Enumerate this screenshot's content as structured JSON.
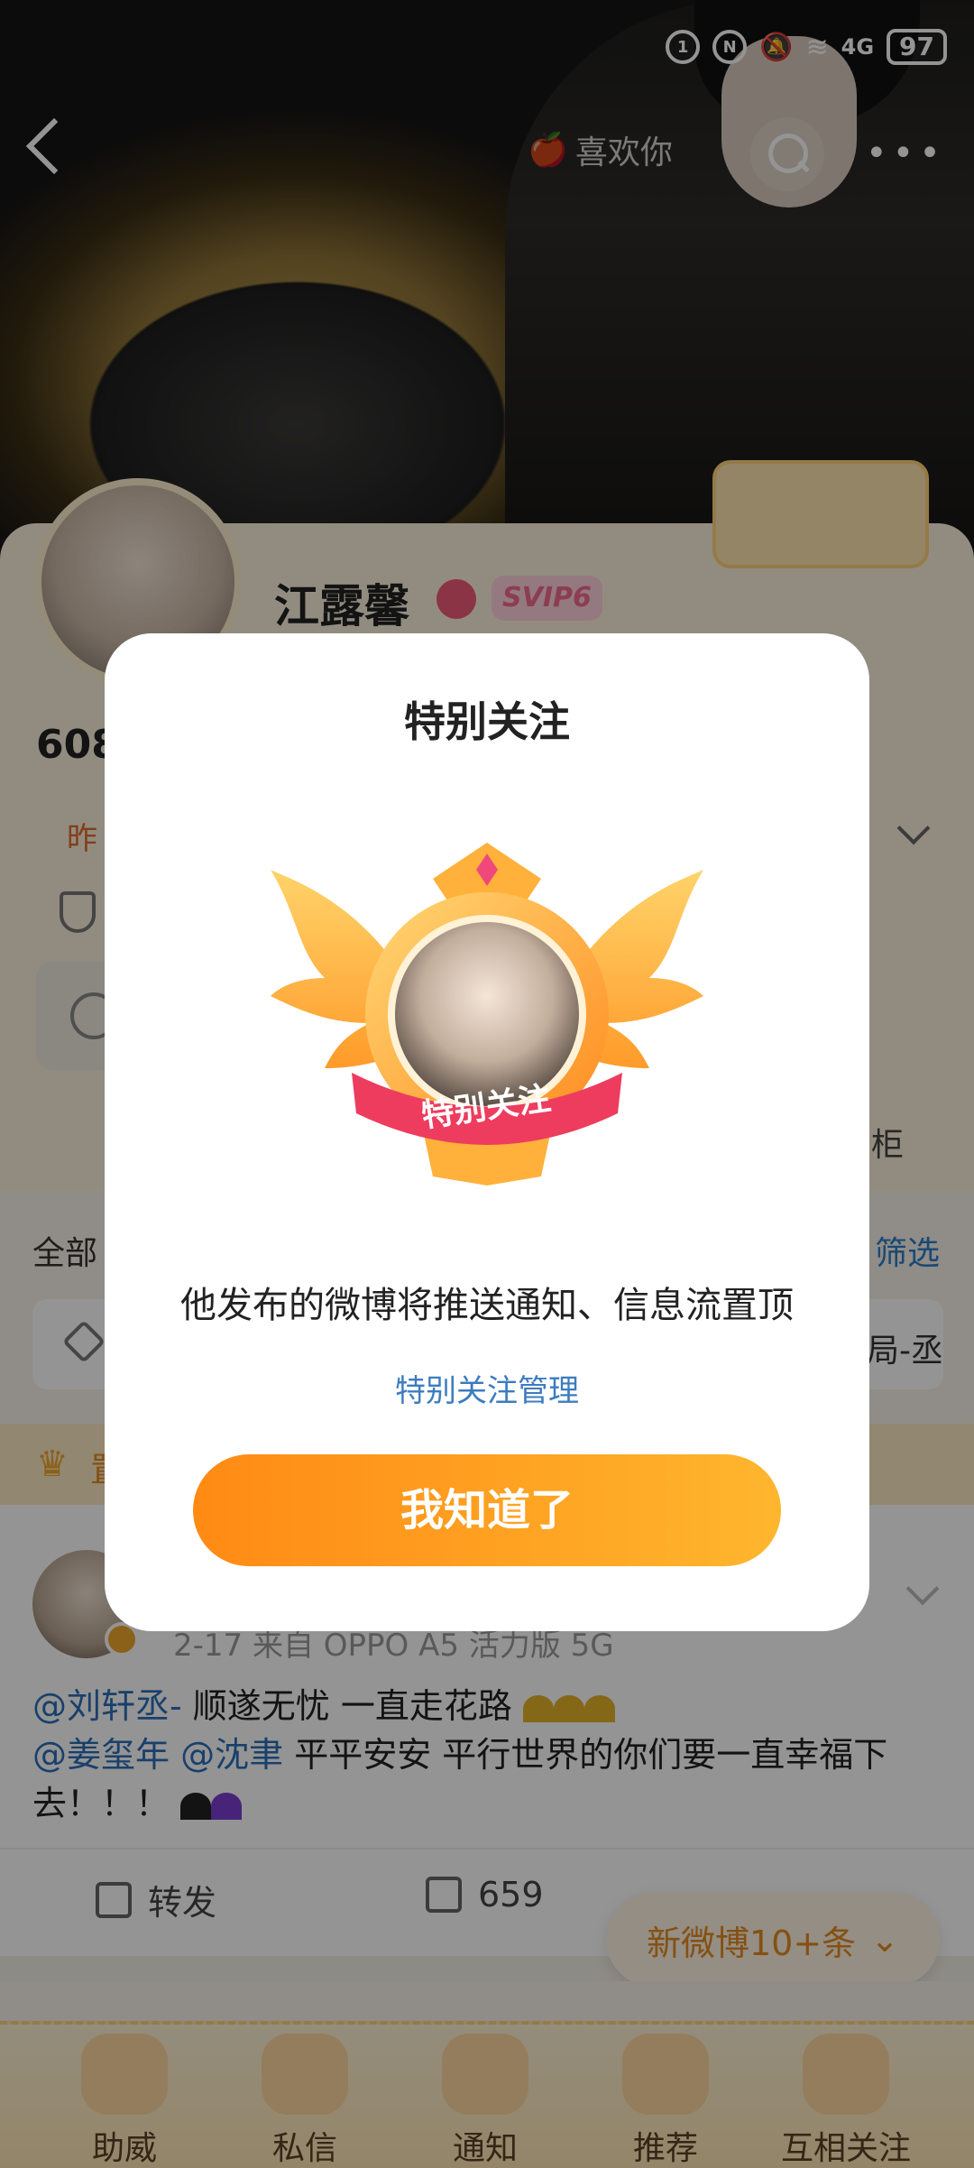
{
  "status_bar": {
    "network": "4G",
    "battery": "97"
  },
  "nav": {
    "like_you": "喜欢你"
  },
  "profile": {
    "name": "江露馨",
    "vip": "SVIP6",
    "followers_partial": "608",
    "yesterday_partial": "昨",
    "right_partial": "柜"
  },
  "tabs": {
    "all": "全部",
    "filter": "筛选",
    "chip_text": "书局-丞"
  },
  "pinned_partial": "置",
  "post": {
    "meta": "2-17  来自 OPPO A5 活力版 5G",
    "mention1": "@刘轩丞-",
    "line1_text": " 顺遂无忧 一直走花路",
    "mention2": "@姜玺年",
    "mention3": "@沈聿",
    "line2_text": " 平平安安 平行世界的你们要一直幸福下去！！！",
    "actions": {
      "repost": "转发",
      "comments": "659"
    }
  },
  "new_posts_button": "新微博10+条",
  "bottom_tabs": [
    {
      "label": "助威"
    },
    {
      "label": "私信"
    },
    {
      "label": "通知"
    },
    {
      "label": "推荐"
    },
    {
      "label": "互相关注"
    }
  ],
  "dialog": {
    "title": "特别关注",
    "emblem_ribbon": "特别关注",
    "description": "他发布的微博将推送通知、信息流置顶",
    "manage_link": "特别关注管理",
    "confirm_button": "我知道了"
  },
  "colors": {
    "accent_orange": "#ff8a14",
    "link_blue": "#3d7cbf"
  }
}
